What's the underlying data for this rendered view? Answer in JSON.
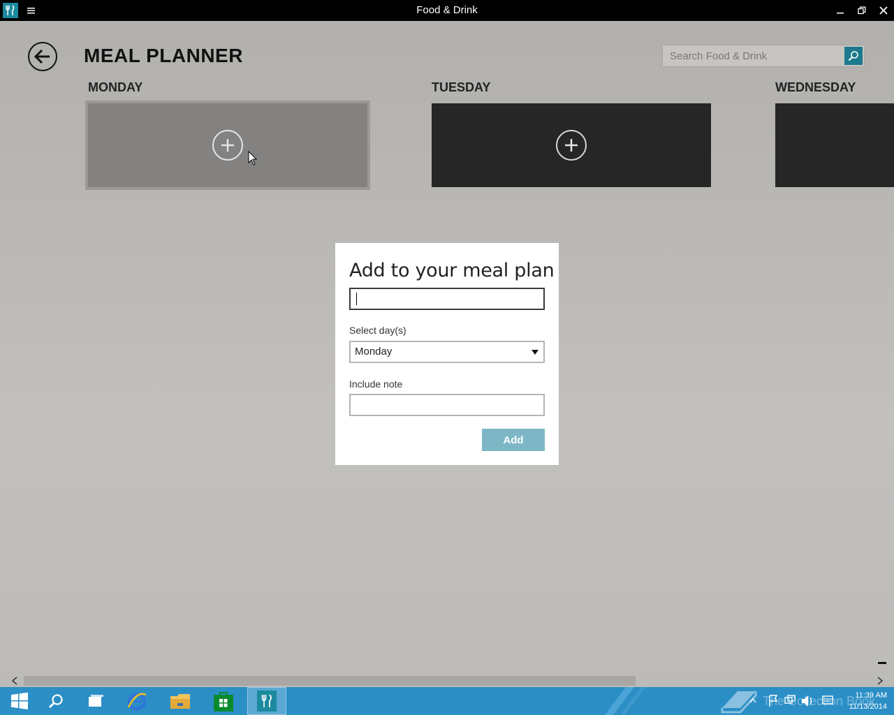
{
  "window": {
    "title": "Food & Drink"
  },
  "header": {
    "page_title": "MEAL PLANNER",
    "search_placeholder": "Search Food & Drink"
  },
  "days": [
    {
      "label": "MONDAY",
      "state": "hover"
    },
    {
      "label": "TUESDAY",
      "state": "normal"
    },
    {
      "label": "WEDNESDAY",
      "state": "normal"
    }
  ],
  "dialog": {
    "title": "Add to your meal plan",
    "meal_value": "",
    "select_label": "Select day(s)",
    "selected_day": "Monday",
    "note_label": "Include note",
    "note_value": "",
    "add_label": "Add"
  },
  "taskbar": {
    "watermark": "The Collection Book",
    "time": "11:39 AM",
    "date": "11/13/2014"
  },
  "colors": {
    "accent": "#1b8a9e",
    "taskbar": "#2b8fc6",
    "add_button": "#7db6c5",
    "tile_dark": "#262626",
    "tile_hover": "#838281"
  }
}
